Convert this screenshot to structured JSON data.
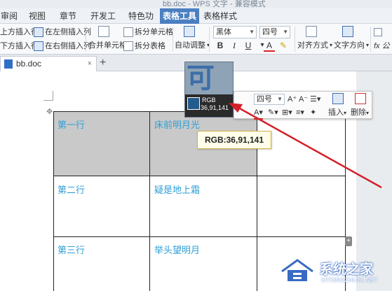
{
  "window": {
    "title": "bb.doc - WPS 文字 - 兼容模式"
  },
  "ribbon_tabs": [
    "审阅",
    "视图",
    "章节",
    "开发工具",
    "特色功能",
    "表格工具",
    "表格样式"
  ],
  "ribbon_tabs_active": "表格工具",
  "ribbon": {
    "insert_row_above": "上方插入行",
    "insert_row_below": "下方插入行",
    "insert_col_left": "在左侧插入列",
    "insert_col_right": "在右侧插入列",
    "merge_cells": "合并单元格",
    "split_cells": "拆分单元格",
    "split_table": "拆分表格",
    "auto_adjust": "自动调整",
    "font_name": "黑体",
    "font_size": "四号",
    "bold": "B",
    "italic": "I",
    "underline": "U",
    "font_color": "A",
    "align_mode": "对齐方式",
    "text_direction": "文字方向",
    "formula": "fx 公"
  },
  "doc_tab": {
    "name": "bb.doc",
    "close": "×",
    "add": "+"
  },
  "table": {
    "rows": [
      [
        "第一行",
        "床前明月光",
        ""
      ],
      [
        "第二行",
        "疑是地上霜",
        ""
      ],
      [
        "第三行",
        "举头望明月",
        ""
      ]
    ],
    "shaded_color": "#c9c9c9",
    "text_color": "#2e9fd6"
  },
  "zoom_preview": {
    "chars": "可明",
    "label": "RGB",
    "value": "36,91,141",
    "swatch_color": "#245b8d"
  },
  "mini_toolbar": {
    "font_size": "四号",
    "grow": "A⁺",
    "shrink": "A⁻",
    "insert": "插入",
    "delete": "删除"
  },
  "tooltip": {
    "text": "RGB:36,91,141"
  },
  "watermark": {
    "title": "系统之家",
    "subtitle": "XITONGZHIJIA.NET"
  }
}
